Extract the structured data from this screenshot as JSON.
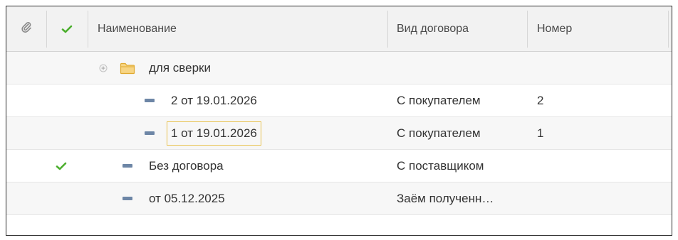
{
  "columns": {
    "attachment_icon": "paperclip-icon",
    "marked_icon": "checkmark-icon",
    "name": "Наименование",
    "contract_type": "Вид договора",
    "number": "Номер"
  },
  "rows": [
    {
      "kind": "group",
      "name": "для сверки",
      "contract_type": "",
      "number": "",
      "checked": false
    },
    {
      "kind": "item",
      "name": "2 от 19.01.2026",
      "contract_type": "С покупателем",
      "number": "2",
      "checked": false
    },
    {
      "kind": "item",
      "name": "1 от 19.01.2026",
      "contract_type": "С покупателем",
      "number": "1",
      "checked": false,
      "selected": true
    },
    {
      "kind": "item",
      "name": "Без договора",
      "contract_type": "С поставщиком",
      "number": "",
      "checked": true
    },
    {
      "kind": "item",
      "name": "от 05.12.2025",
      "contract_type": "Заём полученн…",
      "number": "",
      "checked": false
    }
  ],
  "colors": {
    "check": "#4caf2e",
    "folder": "#f2c14e",
    "item_marker": "#6d86a6",
    "focus_border": "#e8c24e"
  }
}
